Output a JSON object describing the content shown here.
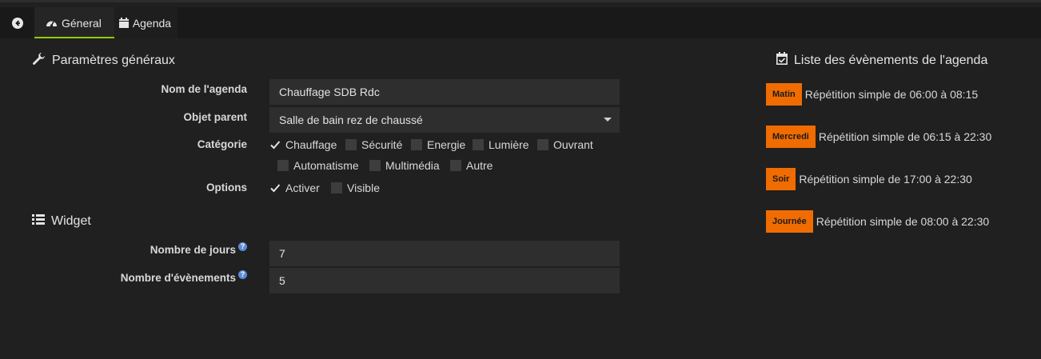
{
  "tabs": {
    "general_label": "Géneral",
    "agenda_label": "Agenda"
  },
  "general": {
    "title": "Paramètres généraux",
    "name_label": "Nom de l'agenda",
    "name_value": "Chauffage SDB Rdc",
    "parent_label": "Objet parent",
    "parent_value": "Salle de bain rez de chaussé",
    "category_label": "Catégorie",
    "categories": [
      {
        "label": "Chauffage",
        "checked": true
      },
      {
        "label": "Sécurité",
        "checked": false
      },
      {
        "label": "Energie",
        "checked": false
      },
      {
        "label": "Lumière",
        "checked": false
      },
      {
        "label": "Ouvrant",
        "checked": false
      },
      {
        "label": "Automatisme",
        "checked": false
      },
      {
        "label": "Multimédia",
        "checked": false
      },
      {
        "label": "Autre",
        "checked": false
      }
    ],
    "options_label": "Options",
    "options": [
      {
        "label": "Activer",
        "checked": true
      },
      {
        "label": "Visible",
        "checked": false
      }
    ]
  },
  "widget": {
    "title": "Widget",
    "days_label": "Nombre de jours",
    "days_value": "7",
    "events_label": "Nombre d'évènements",
    "events_value": "5",
    "help_icon": "?"
  },
  "events_panel": {
    "title": "Liste des évènements de l'agenda",
    "badge_color": "#f06c00",
    "events": [
      {
        "badge": "Matin",
        "text": "Répétition simple de 06:00 à 08:15"
      },
      {
        "badge": "Mercredi",
        "text": "Répétition simple de 06:15 à 22:30"
      },
      {
        "badge": "Soir",
        "text": "Répétition simple de 17:00 à 22:30"
      },
      {
        "badge": "Journée",
        "text": "Répétition simple de 08:00 à 22:30"
      }
    ]
  },
  "icons": {
    "back": "arrow-left-circle-icon",
    "general_tab": "tachometer-icon",
    "agenda_tab": "calendar-icon",
    "general_section": "wrench-icon",
    "widget_section": "list-icon",
    "events_section": "calendar-check-icon"
  },
  "colors": {
    "accent": "#94ca02",
    "help": "#5b8bd6"
  }
}
